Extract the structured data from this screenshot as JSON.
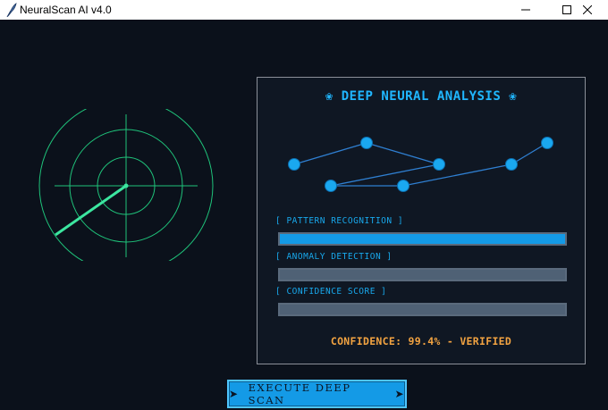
{
  "window": {
    "title": "NeuralScan AI v4.0"
  },
  "colors": {
    "background": "#0b111b",
    "accent": "#149ae6",
    "radar": "#1fc27a",
    "confidence": "#f2a341"
  },
  "panel": {
    "title": "DEEP NEURAL ANALYSIS",
    "title_icon": "brain-icon",
    "metrics": [
      {
        "label": "[ PATTERN RECOGNITION ]",
        "level": 1.0
      },
      {
        "label": "[ ANOMALY DETECTION ]",
        "level": 0.0
      },
      {
        "label": "[ CONFIDENCE SCORE ]",
        "level": 0.0
      }
    ],
    "confidence_text": "CONFIDENCE: 99.4% - VERIFIED"
  },
  "actions": {
    "execute_label": "EXECUTE DEEP SCAN",
    "execute_icon": "rocket-icon"
  }
}
